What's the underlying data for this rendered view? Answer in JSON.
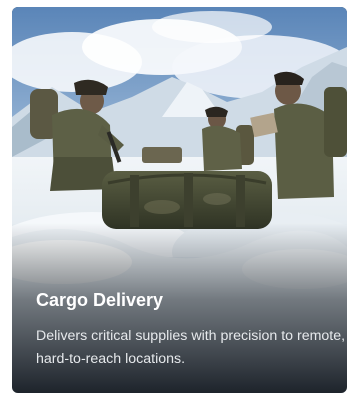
{
  "card": {
    "title": "Cargo Delivery",
    "description": "Delivers critical supplies with precision to remote, hard-to-reach locations.",
    "image_subject": "soldiers-with-cargo-bag-on-snowy-mountain"
  }
}
